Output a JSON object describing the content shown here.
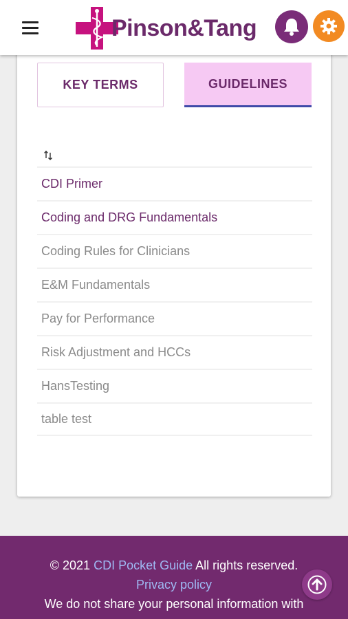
{
  "header": {
    "brand": "Pinson&Tang",
    "menu_icon": "hamburger-menu-icon",
    "notification_icon": "bell-icon",
    "settings_icon": "gear-icon",
    "colors": {
      "brand_purple": "#6b2a6a",
      "bell_bg": "#7a2c78",
      "gear_bg": "#f28a22",
      "logo_pink": "#c6127e"
    }
  },
  "tabs": [
    {
      "label": "KEY TERMS",
      "selected": false
    },
    {
      "label": "GUIDELINES",
      "selected": true
    }
  ],
  "sort_icon": "sort-arrows-icon",
  "guidelines": [
    {
      "title": "CDI Primer",
      "active": true
    },
    {
      "title": "Coding and DRG Fundamentals",
      "active": true
    },
    {
      "title": "Coding Rules for Clinicians",
      "active": false
    },
    {
      "title": "E&M Fundamentals",
      "active": false
    },
    {
      "title": "Pay for Performance",
      "active": false
    },
    {
      "title": "Risk Adjustment and HCCs",
      "active": false
    },
    {
      "title": "HansTesting",
      "active": false
    },
    {
      "title": "table test",
      "active": false
    }
  ],
  "footer": {
    "copyright_prefix": "© 2021",
    "site_link": "CDI Pocket Guide",
    "rights_text": "All rights reserved.",
    "privacy_link": "Privacy policy",
    "note": "We do not share your personal information with",
    "scroll_top_icon": "arrow-up-icon",
    "colors": {
      "background": "#722a6e",
      "link": "#9fb9f3"
    }
  }
}
